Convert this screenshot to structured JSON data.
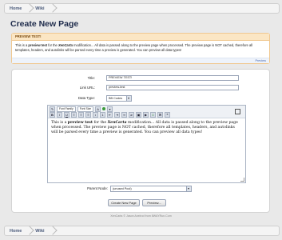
{
  "breadcrumb": {
    "home": "Home",
    "wiki": "Wiki"
  },
  "page_title": "Create New Page",
  "preview": {
    "header": "PREVIEW TEST!",
    "body_prefix": "This is a ",
    "body_bold": "preview test",
    "body_mid": " for the ",
    "body_italic": "XenCarta",
    "body_rest": " modification... All data is passed along to the preview page when processed. The preview page is NOT cached, therefore all templates, headers, and autolinks will be parsed every time a preview is generated. You can preview all data types!",
    "footer_link": "Preview"
  },
  "form": {
    "title_label": "Title:",
    "title_value": "PREVIEW TEST!",
    "link_label": "Link URL:",
    "link_value": "preview-test",
    "datatype_label": "Data Type:",
    "datatype_value": "BB Codes",
    "parent_label": "Parent Node:",
    "parent_value": "(unused Pool)",
    "create_button": "Create New Page",
    "preview_button": "Preview..."
  },
  "editor": {
    "font_family": "Font Family",
    "font_size": "Font Size",
    "body_prefix": "This is a ",
    "body_bold": "preview test",
    "body_mid": " for the ",
    "body_italic": "XenCarta",
    "body_rest": " modification... All data is passed along to the preview page when processed. The preview page is NOT cached, therefore all templates, headers, and autolinks will be parsed every time a preview is generated. You can preview all data types!"
  },
  "footer": "XenCarta © Jason Axelrod from 8WAYRun.Com",
  "colors": {
    "accent": "#1d2a4a",
    "preview_border": "#f0c890",
    "link": "#4a6ab0"
  }
}
